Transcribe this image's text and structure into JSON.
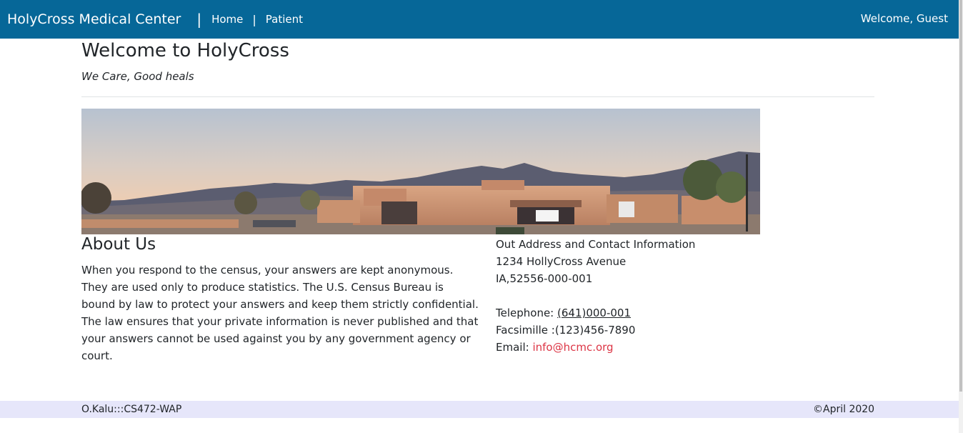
{
  "navbar": {
    "brand": "HolyCross Medical Center",
    "separator": "|",
    "links": [
      {
        "label": "Home"
      },
      {
        "label": "Patient"
      }
    ],
    "welcome": "Welcome, Guest",
    "color": "#066798"
  },
  "header": {
    "title": "Welcome to HolyCross",
    "tagline": "We Care, Good heals"
  },
  "about": {
    "title": "About Us",
    "text": "When you respond to the census, your answers are kept anonymous. They are used only to produce statistics. The U.S. Census Bureau is bound by law to protect your answers and keep them strictly confidential. The law ensures that your private information is never published and that your answers cannot be used against you by any government agency or court."
  },
  "contact": {
    "heading": "Out Address and Contact Information",
    "street": "1234 HollyCross Avenue",
    "city": "IA,52556-000-001",
    "phone_label": "Telephone: ",
    "phone": "(641)000-001",
    "fax": "Facsimille :(123)456-7890",
    "email_label": "Email: ",
    "email": "info@hcmc.org",
    "email_color": "#dc3545"
  },
  "footer": {
    "left": "O.Kalu:::CS472-WAP",
    "right": "©April 2020",
    "background": "#e6e6fa"
  }
}
